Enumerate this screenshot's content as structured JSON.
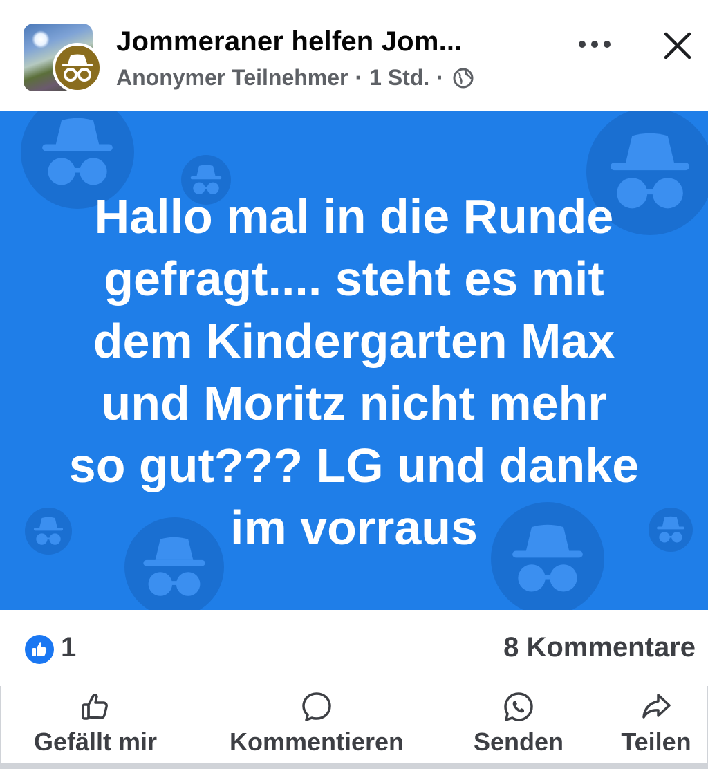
{
  "header": {
    "group_name": "Jommeraner helfen Jom...",
    "author": "Anonymer Teilnehmer",
    "separator": "·",
    "time": "1 Std.",
    "privacy_icon": "globe-icon",
    "more_icon": "more-horizontal-icon",
    "close_icon": "close-icon"
  },
  "post": {
    "background_color": "#1f7ee8",
    "lines": [
      "Hallo mal in die Runde",
      "gefragt.... steht es mit",
      "dem Kindergarten Max",
      "und Moritz nicht mehr",
      "so gut??? LG und danke",
      "im vorraus"
    ]
  },
  "stats": {
    "like_count": "1",
    "comments": "8 Kommentare"
  },
  "actions": [
    {
      "label": "Gefällt mir",
      "icon": "thumbs-up-icon"
    },
    {
      "label": "Kommentieren",
      "icon": "comment-icon"
    },
    {
      "label": "Senden",
      "icon": "whatsapp-icon"
    },
    {
      "label": "Teilen",
      "icon": "share-icon"
    }
  ],
  "colors": {
    "accent": "#1a77f2",
    "text_secondary": "#5e6166"
  }
}
